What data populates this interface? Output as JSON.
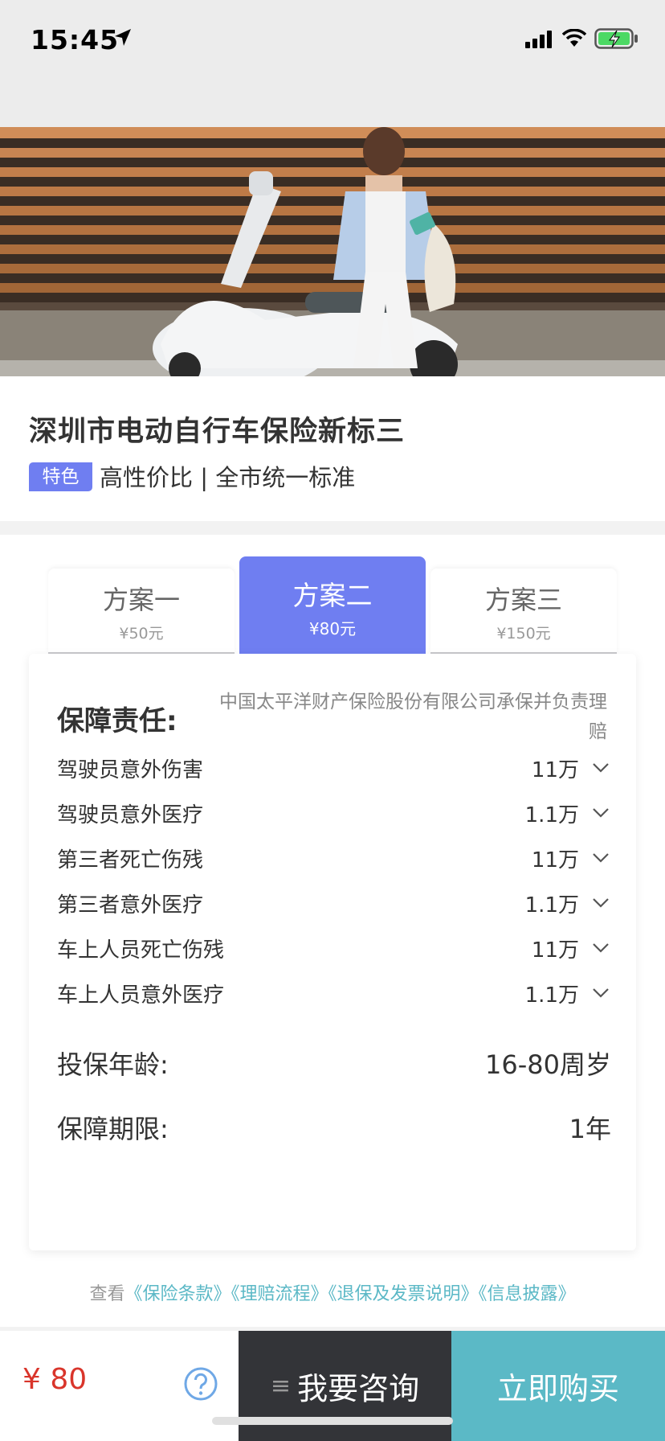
{
  "status_bar": {
    "time": "15:45",
    "icons": [
      "location-arrow-icon",
      "cellular-signal-icon",
      "wifi-icon",
      "battery-charging-icon"
    ]
  },
  "hero": {
    "image": "hero-photo"
  },
  "product": {
    "title": "深圳市电动自行车保险新标三",
    "badge": "特色",
    "features": "高性价比 | 全市统一标准"
  },
  "plans": {
    "tabs": [
      {
        "name": "方案一",
        "price": "¥50元",
        "selected": false
      },
      {
        "name": "方案二",
        "price": "¥80元",
        "selected": true
      },
      {
        "name": "方案三",
        "price": "¥150元",
        "selected": false
      }
    ]
  },
  "coverage": {
    "label": "保障责任:",
    "insurer": "中国太平洋财产保险股份有限公司承保并负责理赔",
    "items": [
      {
        "name": "驾驶员意外伤害",
        "value": "11万"
      },
      {
        "name": "驾驶员意外医疗",
        "value": "1.1万"
      },
      {
        "name": "第三者死亡伤残",
        "value": "11万"
      },
      {
        "name": "第三者意外医疗",
        "value": "1.1万"
      },
      {
        "name": "车上人员死亡伤残",
        "value": "11万"
      },
      {
        "name": "车上人员意外医疗",
        "value": "1.1万"
      }
    ],
    "age_label": "投保年龄:",
    "age_value": "16-80周岁",
    "term_label": "保障期限:",
    "term_value": "1年"
  },
  "links": {
    "prefix": "查看",
    "items": [
      "《保险条款》",
      "《理赔流程》",
      "《退保及发票说明》",
      "《信息披露》"
    ]
  },
  "bottom": {
    "price": "¥ 80",
    "consult_icon": "≡",
    "consult_label": "我要咨询",
    "buy_label": "立即购买"
  },
  "colors": {
    "accent": "#6f7ef1",
    "buy": "#5bb9c6",
    "price": "#d9352b",
    "link": "#5bb8c6",
    "consult_bg": "#333438"
  }
}
